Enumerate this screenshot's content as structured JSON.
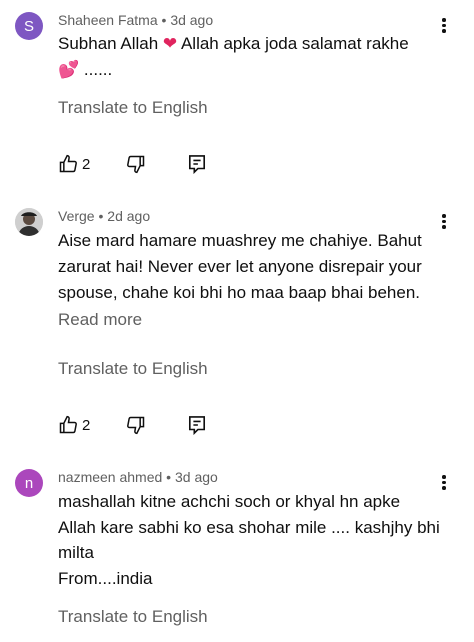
{
  "comments": [
    {
      "avatar_letter": "S",
      "avatar_color": "#7e57c2",
      "author": "Shaheen Fatma",
      "time": "3d ago",
      "lines": [
        "Subhan Allah ",
        " Allah apka joda salamat rakhe",
        " ......"
      ],
      "emoji_heart": "❤",
      "emoji_hearts": "💕",
      "translate": "Translate to English",
      "likes": "2"
    },
    {
      "author": "Verge",
      "time": "2d ago",
      "lines": [
        "Aise mard hamare muashrey me chahiye. Bahut",
        "zarurat hai! Never ever let anyone disrepair your",
        "spouse, chahe koi bhi ho maa baap bhai behen."
      ],
      "read_more": "Read more",
      "translate": "Translate to English",
      "likes": "2"
    },
    {
      "avatar_letter": "n",
      "avatar_color": "#ab47bc",
      "author": "nazmeen ahmed",
      "time": "3d ago",
      "lines": [
        "mashallah kitne achchi soch or khyal hn apke",
        "Allah kare sabhi ko esa shohar mile .... kashjhy bhi",
        "milta",
        "From....india"
      ],
      "translate": "Translate to English"
    }
  ],
  "separator": " • "
}
